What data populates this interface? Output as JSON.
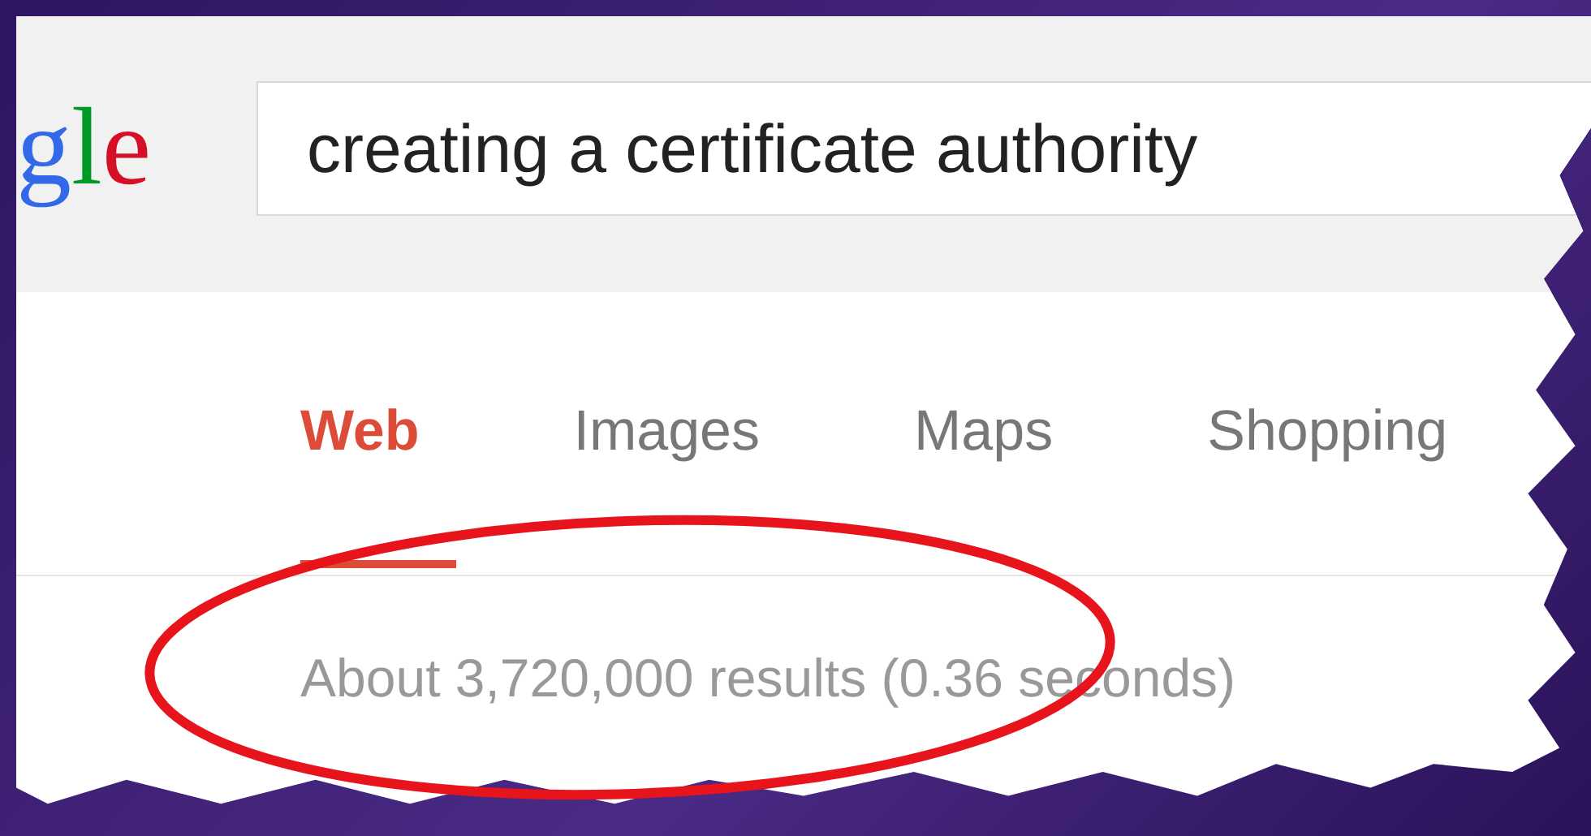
{
  "logo": {
    "letters": [
      {
        "text": "g",
        "color": "#3369e8"
      },
      {
        "text": "l",
        "color": "#009925"
      },
      {
        "text": "e",
        "color": "#d50f25"
      }
    ]
  },
  "search": {
    "value": "creating a certificate authority"
  },
  "tabs": [
    {
      "label": "Web",
      "selected": true
    },
    {
      "label": "Images",
      "selected": false
    },
    {
      "label": "Maps",
      "selected": false
    },
    {
      "label": "Shopping",
      "selected": false
    }
  ],
  "result_stats": "About 3,720,000 results (0.36 seconds)"
}
